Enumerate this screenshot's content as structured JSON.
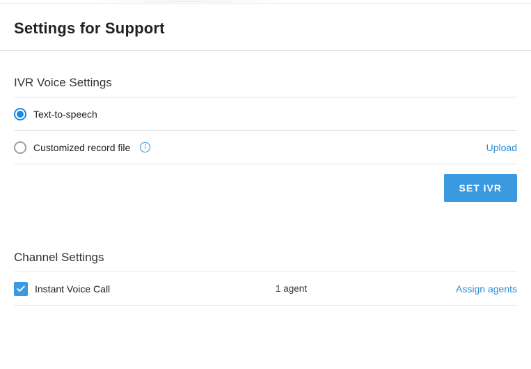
{
  "page": {
    "title": "Settings for Support"
  },
  "ivr": {
    "section_title": "IVR Voice Settings",
    "options": {
      "tts_label": "Text-to-speech",
      "custom_label": "Customized record file"
    },
    "upload_link": "Upload",
    "set_button": "SET IVR"
  },
  "channel": {
    "section_title": "Channel Settings",
    "row": {
      "label": "Instant Voice Call",
      "agent_count": "1 agent",
      "assign_link": "Assign agents"
    }
  }
}
